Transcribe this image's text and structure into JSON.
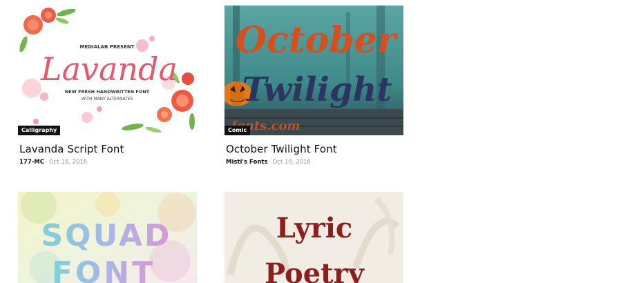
{
  "posts": [
    {
      "category": "Calligraphy",
      "title": "Lavanda Script Font",
      "author": "177-MC",
      "date": "Oct 18, 2016",
      "preview": {
        "kicker": "MEDIALAB PRESENT",
        "wordmark": "Lavanda",
        "line1": "NEW FRESH HANDWRITTEN FONT",
        "line2": "WITH MANY ALTERNATES",
        "colors": {
          "accent": "#e8485f",
          "leaf": "#6fb54a"
        }
      }
    },
    {
      "category": "Comic",
      "title": "October Twilight Font",
      "author": "Misti's Fonts",
      "date": "Oct 18, 2016",
      "preview": {
        "line1": "October",
        "line2": "Twilight",
        "watermark": "fonts.com",
        "colors": {
          "line1": "#d4501e",
          "line2": "#2a3660",
          "bg": "#3f8a8a"
        }
      }
    },
    {
      "category": "",
      "title": "",
      "author": "",
      "date": "",
      "preview": {
        "line1": "SQUAD",
        "line2": "FONT",
        "colors": {
          "text": "#7fc7d9"
        }
      }
    },
    {
      "category": "",
      "title": "",
      "author": "",
      "date": "",
      "preview": {
        "line1": "Lyric",
        "line2": "Poetry",
        "colors": {
          "text": "#8e1d1d",
          "bg": "#f1ede4"
        }
      }
    }
  ]
}
